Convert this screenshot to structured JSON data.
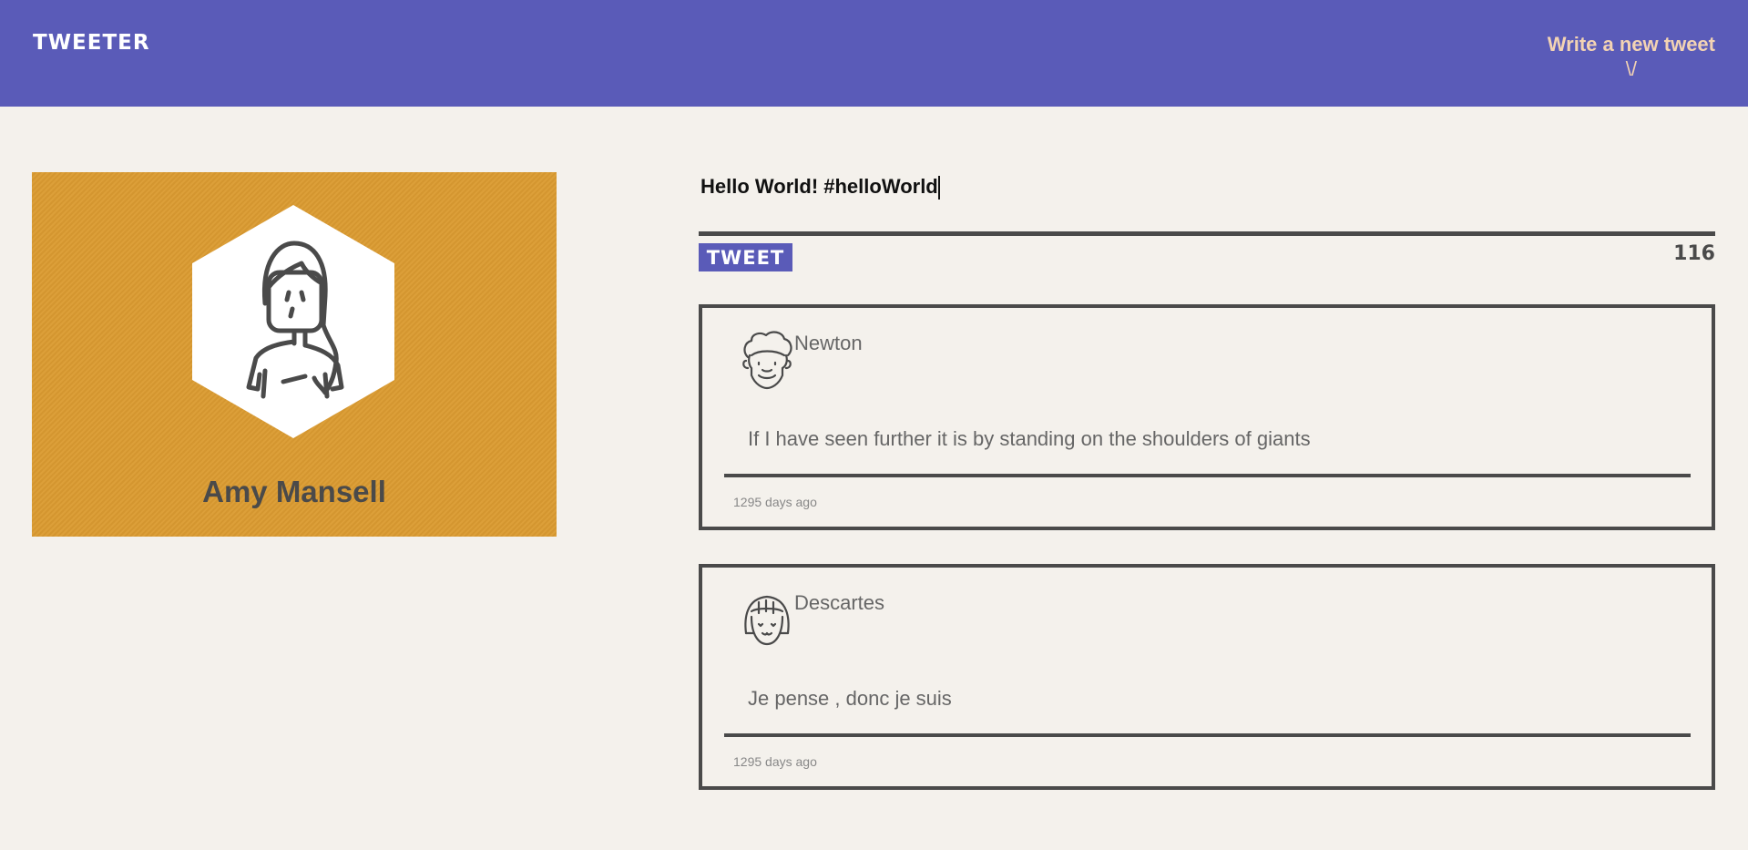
{
  "header": {
    "brand": "TWEETER",
    "compose_label": "Write a new tweet",
    "compose_arrow": "\\/"
  },
  "profile": {
    "name": "Amy Mansell",
    "card_color": "#db9b31"
  },
  "compose": {
    "text": "Hello World! #helloWorld",
    "button_label": "TWEET",
    "counter": "116"
  },
  "tweets": [
    {
      "author": "Newton",
      "avatar_icon": "curly-hair-face-icon",
      "text": "If I have seen further it is by standing on the shoulders of giants",
      "time": "1295 days ago"
    },
    {
      "author": "Descartes",
      "avatar_icon": "bob-hair-face-icon",
      "text": "Je pense , donc je suis",
      "time": "1295 days ago"
    }
  ],
  "colors": {
    "navbar": "#5a5bb8",
    "accent": "#f3d3b3",
    "background": "#f4f1ec",
    "border": "#4a4a4a"
  }
}
